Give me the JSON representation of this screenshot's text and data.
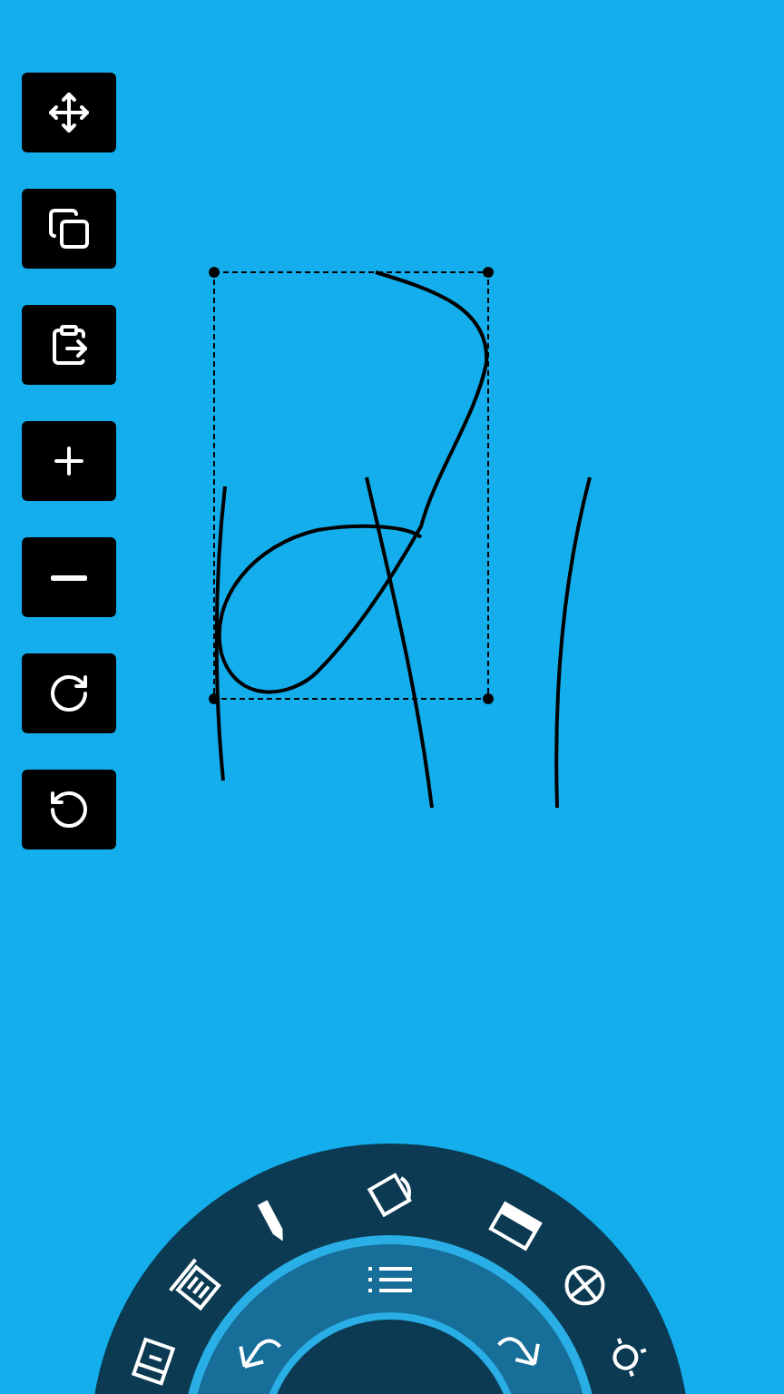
{
  "toolbar": [
    {
      "kind": "move"
    },
    {
      "kind": "copy"
    },
    {
      "kind": "paste"
    },
    {
      "kind": "zoom_in"
    },
    {
      "kind": "zoom_out"
    },
    {
      "kind": "rotate_cw"
    },
    {
      "kind": "rotate_ccw"
    }
  ],
  "canvas": {
    "selection": true
  },
  "radial_menu": {
    "outer": [
      {
        "kind": "notes"
      },
      {
        "kind": "trash"
      },
      {
        "kind": "pencil"
      },
      {
        "kind": "bucket"
      },
      {
        "kind": "eraser"
      },
      {
        "kind": "wheel"
      },
      {
        "kind": "light"
      }
    ],
    "inner": [
      {
        "kind": "undo"
      },
      {
        "kind": "list"
      },
      {
        "kind": "redo"
      }
    ]
  }
}
